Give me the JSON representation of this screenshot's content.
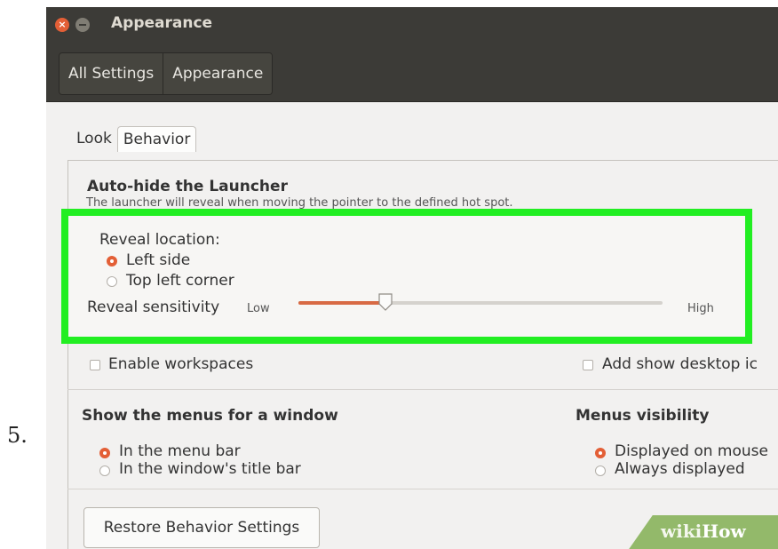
{
  "step_number": "5.",
  "window": {
    "title": "Appearance",
    "close_glyph": "×",
    "breadcrumbs": [
      "All Settings",
      "Appearance"
    ]
  },
  "tabs": [
    "Look",
    "Behavior"
  ],
  "active_tab": "Behavior",
  "autohide": {
    "title": "Auto-hide the Launcher",
    "description": "The launcher will reveal when moving the pointer to the defined hot spot.",
    "reveal_location_label": "Reveal location:",
    "options": [
      "Left side",
      "Top left corner"
    ],
    "selected_option": "Left side",
    "sensitivity_label": "Reveal sensitivity",
    "sensitivity_low": "Low",
    "sensitivity_high": "High",
    "sensitivity_value": 0.24
  },
  "checkboxes": {
    "workspaces": "Enable workspaces",
    "show_desktop": "Add show desktop ic"
  },
  "menus": {
    "title": "Show the menus for a window",
    "options": [
      "In the menu bar",
      "In the window's title bar"
    ],
    "selected": "In the menu bar"
  },
  "visibility": {
    "title": "Menus visibility",
    "options": [
      "Displayed on mouse",
      "Always displayed"
    ],
    "selected": "Displayed on mouse"
  },
  "restore_button": "Restore Behavior Settings",
  "watermark": {
    "wiki": "wiki",
    "how": "How"
  },
  "colors": {
    "accent": "#e35f36",
    "highlight": "#22ee22",
    "titlebar": "#3c3b37",
    "slider_fill": "#d86a44"
  },
  "icons": [
    "close-icon",
    "minimize-icon",
    "slider-handle-icon"
  ]
}
